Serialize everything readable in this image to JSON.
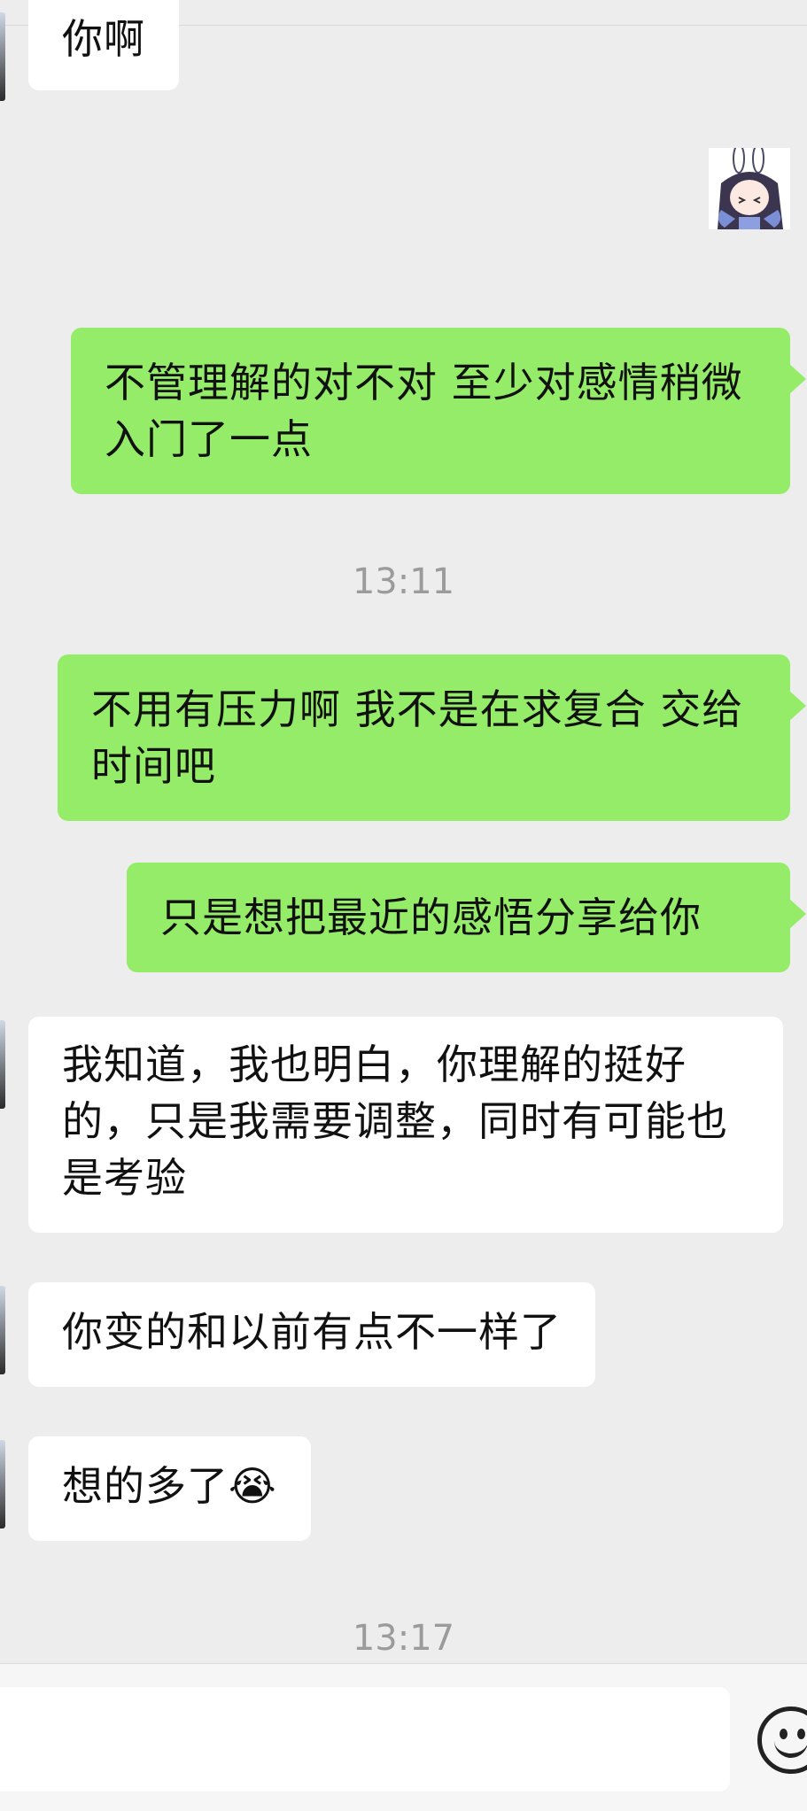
{
  "chat": {
    "messages": [
      {
        "id": "m1",
        "side": "incoming",
        "text": "你啊"
      },
      {
        "id": "m2",
        "side": "outgoing",
        "type": "sticker",
        "icon": "anime-girl-sticker"
      },
      {
        "id": "m3",
        "side": "outgoing",
        "text": "不管理解的对不对 至少对感情稍微入门了一点"
      },
      {
        "id": "m4",
        "side": "outgoing",
        "text": "不用有压力啊 我不是在求复合 交给时间吧"
      },
      {
        "id": "m5",
        "side": "outgoing",
        "text": "只是想把最近的感悟分享给你"
      },
      {
        "id": "m6",
        "side": "incoming",
        "text": "我知道，我也明白，你理解的挺好的，只是我需要调整，同时有可能也是考验"
      },
      {
        "id": "m7",
        "side": "incoming",
        "text": "你变的和以前有点不一样了"
      },
      {
        "id": "m8",
        "side": "incoming",
        "text": "想的多了",
        "emoji": "😭"
      }
    ],
    "timestamps": [
      "13:11",
      "13:17"
    ]
  },
  "input_bar": {
    "value": "",
    "emoji_button_icon": "smiley-face-icon"
  },
  "colors": {
    "background": "#ededed",
    "incoming_bubble": "#ffffff",
    "outgoing_bubble": "#95ec69",
    "timestamp_text": "#9b9b9b"
  }
}
